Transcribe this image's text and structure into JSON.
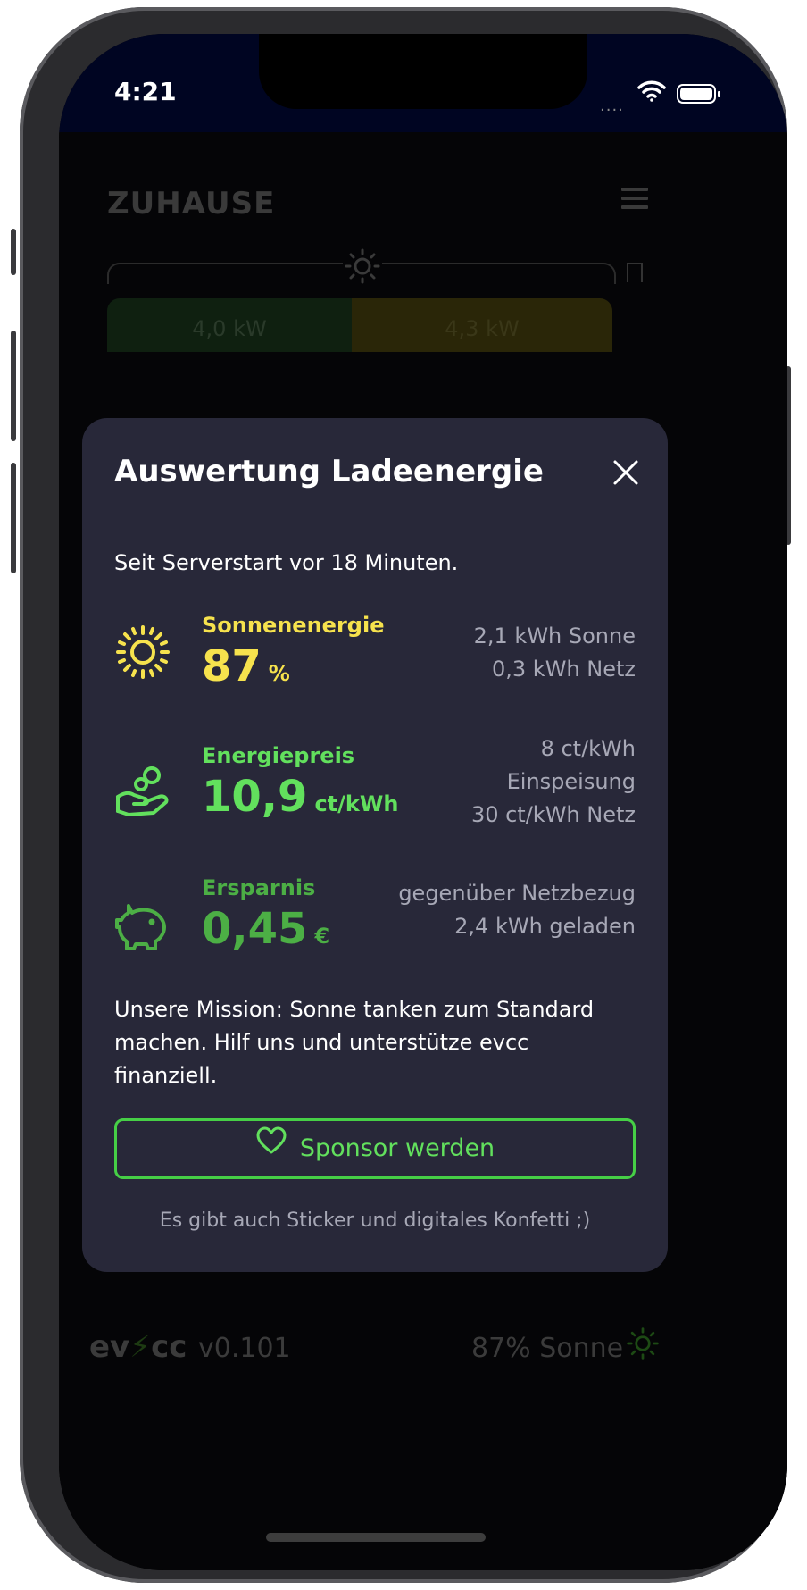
{
  "status_bar": {
    "time": "4:21",
    "signal": "....",
    "wifi_icon": "wifi-icon",
    "battery_icon": "battery-icon"
  },
  "background_app": {
    "title": "ZUHAUSE",
    "menu_icon": "hamburger-menu-icon",
    "power_bar": [
      {
        "label": "4,0 kW",
        "color": "#0f2010"
      },
      {
        "label": "4,3 kW",
        "color": "#2a2608"
      }
    ],
    "pager": {
      "count": 2,
      "active": 0
    },
    "footer": {
      "logo": "evcc",
      "version": "v0.101",
      "solar_summary": "87% Sonne"
    }
  },
  "modal": {
    "title": "Auswertung Ladeenergie",
    "close_icon": "close-icon",
    "since": "Seit Serverstart vor 18 Minuten.",
    "stats": [
      {
        "icon": "sun-icon",
        "label": "Sonnenenergie",
        "value": "87",
        "unit": "%",
        "color": "#f6e24d",
        "details": [
          "2,1 kWh Sonne",
          "0,3 kWh Netz"
        ]
      },
      {
        "icon": "hand-coins-icon",
        "label": "Energiepreis",
        "value": "10,9",
        "unit": "ct/kWh",
        "color": "#62e05d",
        "details": [
          "8 ct/kWh",
          "Einspeisung",
          "30 ct/kWh Netz"
        ]
      },
      {
        "icon": "piggy-bank-icon",
        "label": "Ersparnis",
        "value": "0,45",
        "unit": "€",
        "color": "#4caf45",
        "details": [
          "gegenüber Netzbezug",
          "2,4 kWh geladen"
        ]
      }
    ],
    "mission": "Unsere Mission: Sonne tanken zum Standard machen. Hilf uns und unterstütze evcc finanziell.",
    "sponsor_button": {
      "label": "Sponsor werden",
      "icon": "heart-icon",
      "color": "#46cf46"
    },
    "sticker_note": "Es gibt auch Sticker und digitales Konfetti ;)"
  }
}
